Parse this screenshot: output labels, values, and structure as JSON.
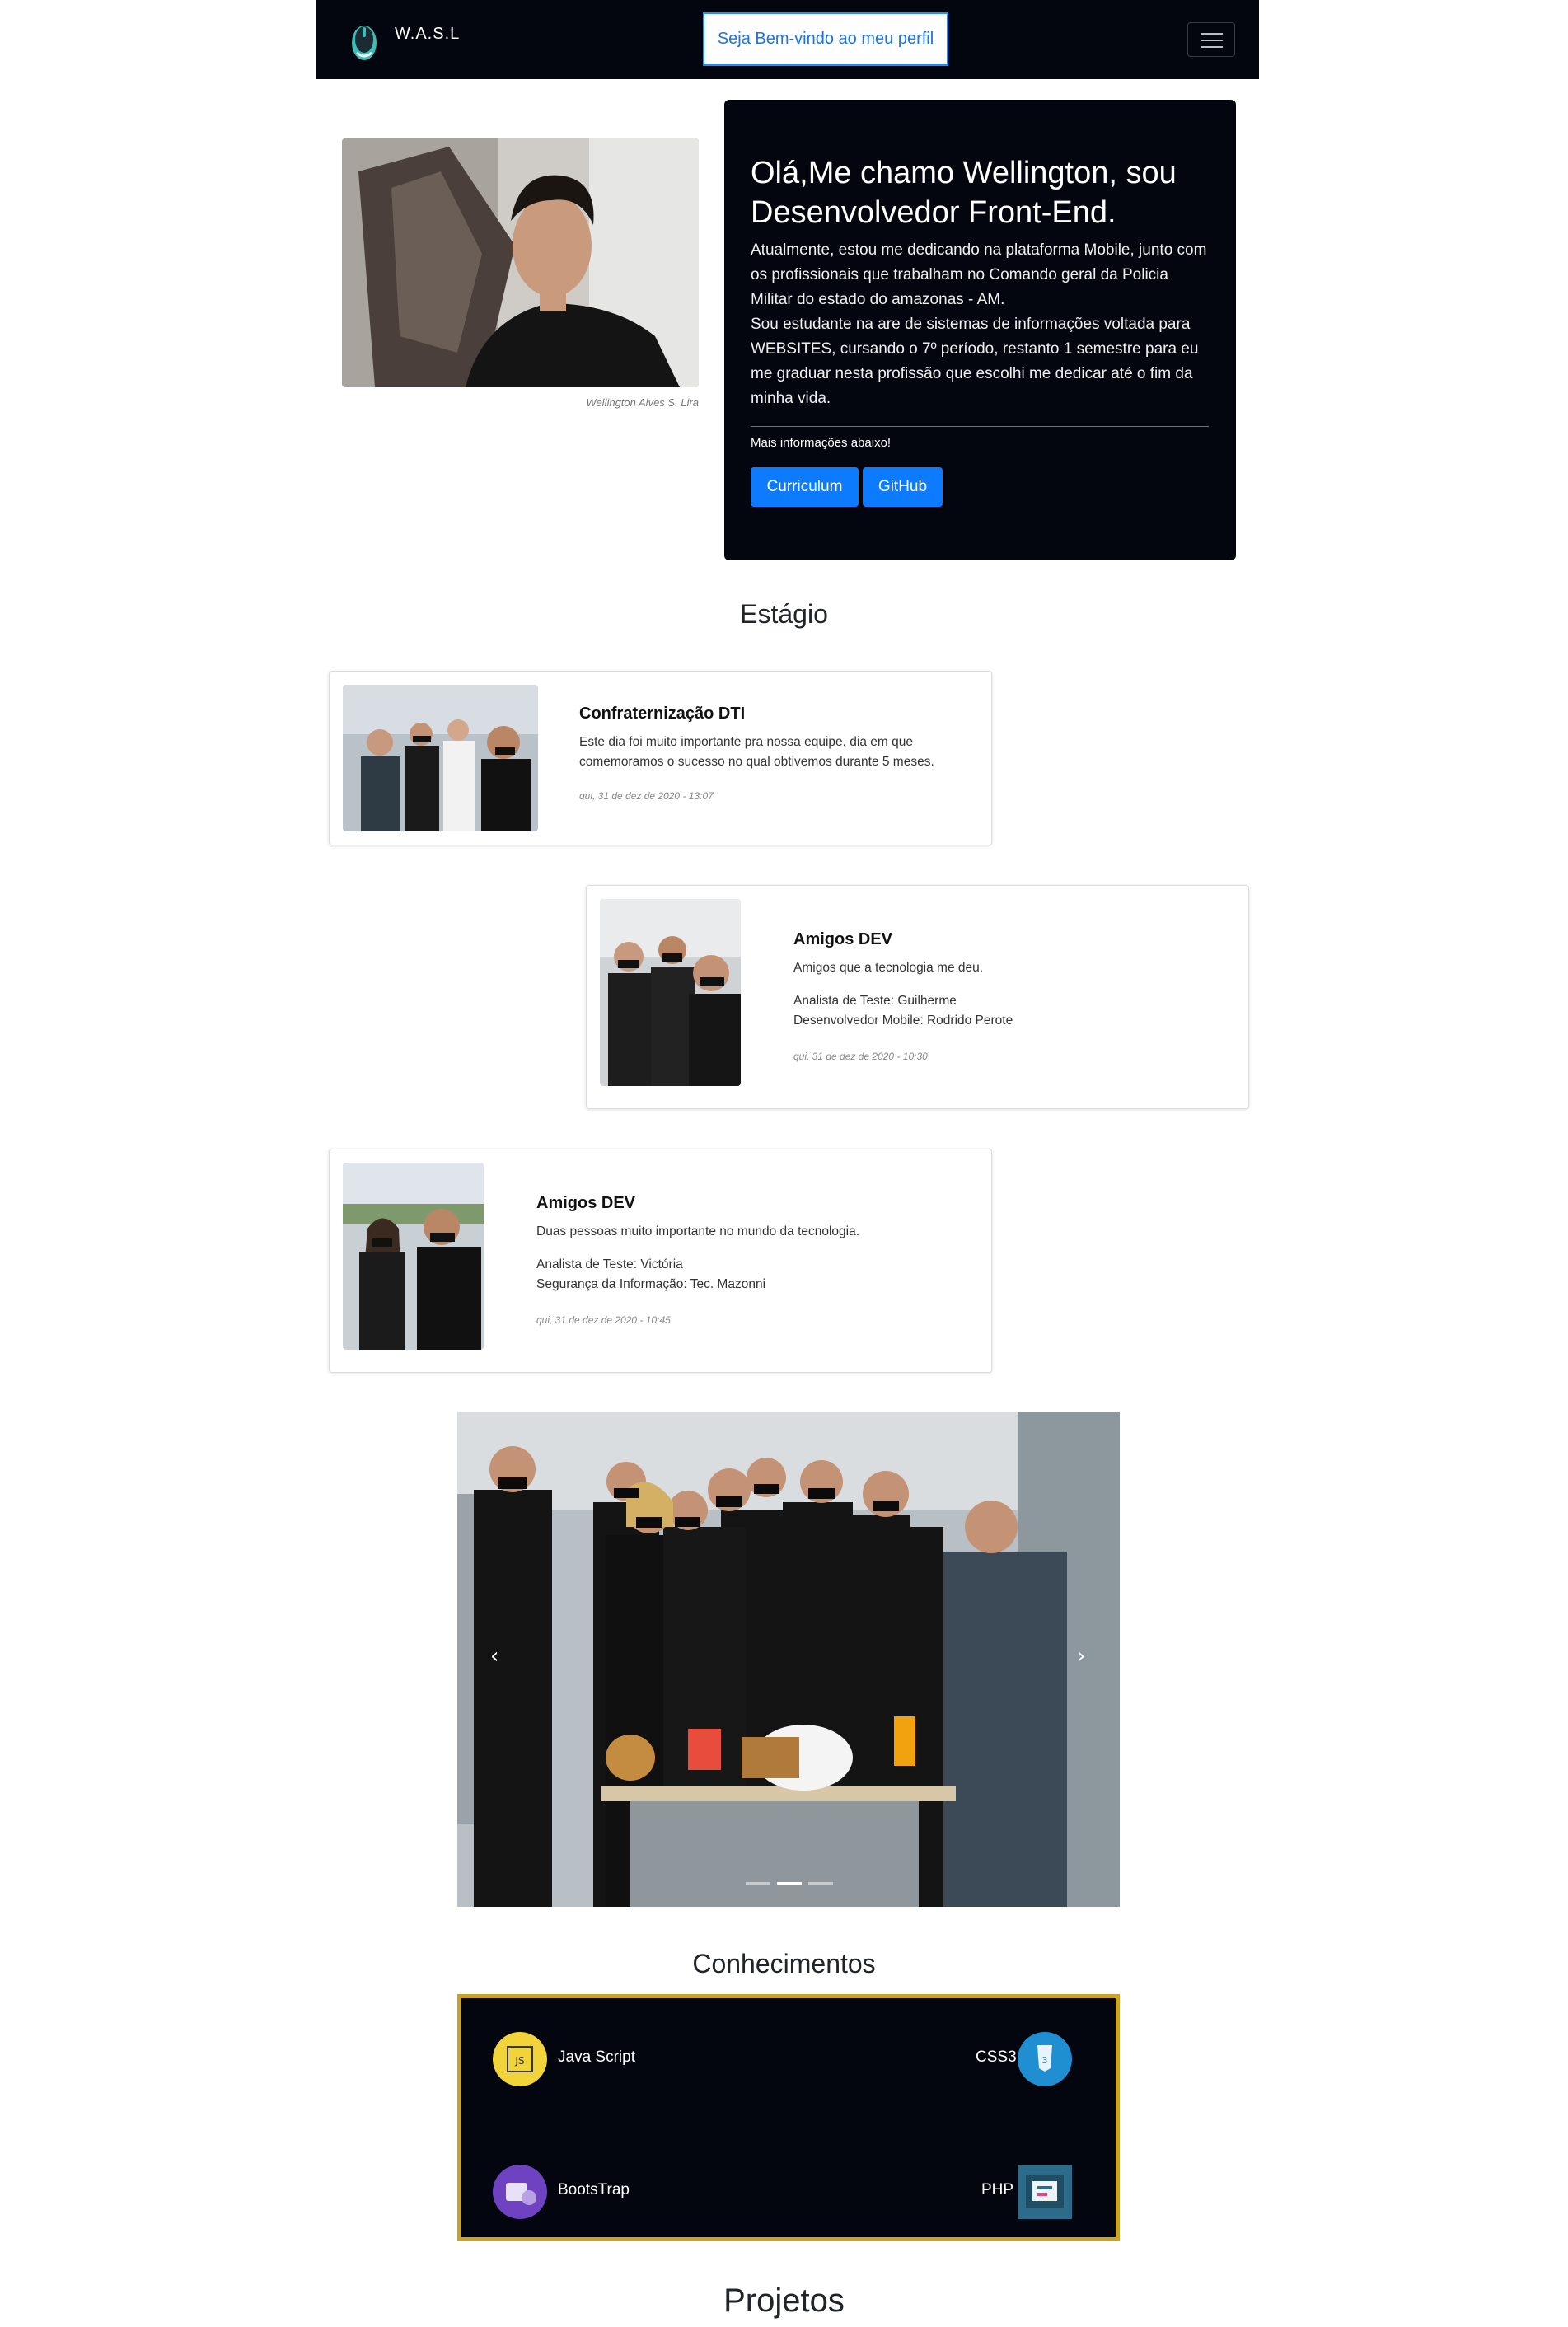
{
  "navbar": {
    "brand": "W.A.S.L",
    "welcome": "Seja Bem-vindo ao meu perfil",
    "brand_icon": "mouse-icon",
    "toggler_icon": "hamburger-icon"
  },
  "profile": {
    "photo_caption": "Wellington Alves S. Lira",
    "title": "Olá,Me chamo Wellington, sou Desenvolvedor Front-End.",
    "paragraph1": "Atualmente, estou me dedicando na plataforma Mobile, junto com os profissionais que trabalham no Comando geral da Policia Militar do estado do amazonas - AM.",
    "paragraph2": "Sou estudante na are de sistemas de informações voltada para WEBSITES, cursando o 7º período, restanto 1 semestre para eu me graduar nesta profissão que escolhi me dedicar até o fim da minha vida.",
    "more_info": "Mais informações abaixo!",
    "buttons": [
      "Curriculum",
      "GitHub"
    ]
  },
  "estagio": {
    "title": "Estágio",
    "cards": [
      {
        "title": "Confraternização DTI",
        "text": "Este dia foi muito importante pra nossa equipe, dia em que comemoramos o sucesso no qual obtivemos durante 5 meses.",
        "extra1": "",
        "extra2": "",
        "date": "qui, 31 de dez de 2020 - 13:07"
      },
      {
        "title": "Amigos DEV",
        "text": "Amigos que a tecnologia me deu.",
        "extra1": "Analista de Teste: Guilherme",
        "extra2": "Desenvolvedor Mobile: Rodrido Perote",
        "date": "qui, 31 de dez de 2020 - 10:30"
      },
      {
        "title": "Amigos DEV",
        "text": "Duas pessoas muito importante no mundo da tecnologia.",
        "extra1": "Analista de Teste: Victória",
        "extra2": "Segurança da Informação: Tec. Mazonni",
        "date": "qui, 31 de dez de 2020 - 10:45"
      }
    ]
  },
  "carousel": {
    "prev_icon": "chevron-left-icon",
    "next_icon": "chevron-right-icon",
    "slides": 3,
    "active": 2
  },
  "conhecimentos": {
    "title": "Conhecimentos",
    "skills": [
      "Java Script",
      "CSS3",
      "BootsTrap",
      "PHP"
    ],
    "border_color": "#c9a227"
  },
  "projetos": {
    "title": "Projetos"
  },
  "colors": {
    "dark": "#03060f",
    "primary": "#0d7bff"
  }
}
